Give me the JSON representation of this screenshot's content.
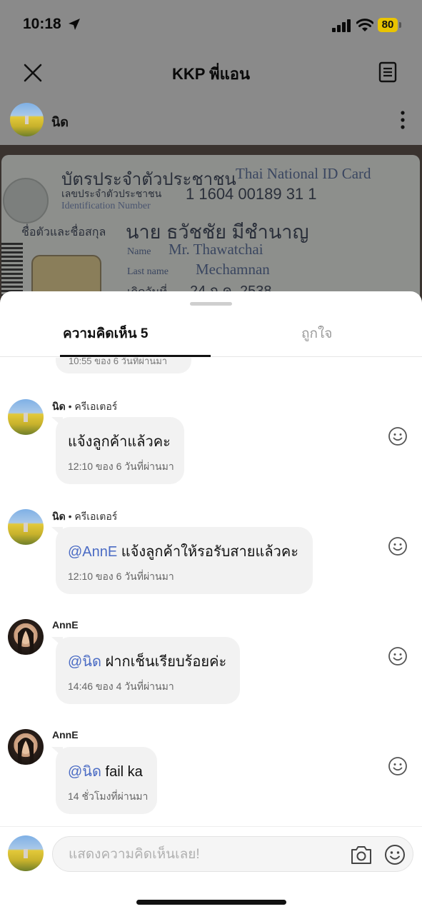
{
  "status_bar": {
    "time": "10:18",
    "battery": "80"
  },
  "header": {
    "title": "KKP พี่แอน"
  },
  "post": {
    "author": "นิด",
    "id_card": {
      "title_th": "บัตรประจำตัวประชาชน",
      "title_en": "Thai National ID Card",
      "id_label_th": "เลขประจำตัวประชาชน",
      "id_label_en": "Identification Number",
      "id_number": "1 1604 00189 31 1",
      "name_label_th": "ชื่อตัวและชื่อสกุล",
      "name_th": "นาย ธวัชชัย มีชำนาญ",
      "name_label_en": "Name",
      "name_en": "Mr. Thawatchai",
      "lastname_label_en": "Last name",
      "lastname_en": "Mechamnan",
      "birth_label_th": "เกิดวันที่",
      "birth_th": "24 ก.ค. 2538"
    }
  },
  "tabs": [
    {
      "label": "ความคิดเห็น 5",
      "active": true
    },
    {
      "label": "ถูกใจ",
      "active": false
    }
  ],
  "partial_comment": {
    "time": "10:55 ของ 6 วันที่ผ่านมา"
  },
  "comments": [
    {
      "author": "นิด",
      "role": "ครีเอเตอร์",
      "mention": "",
      "text": "แจ้งลูกค้าแล้วคะ",
      "time": "12:10 ของ 6 วันที่ผ่านมา"
    },
    {
      "author": "นิด",
      "role": "ครีเอเตอร์",
      "mention": "@AnnE",
      "text": " แจ้งลูกค้าให้รอรับสายแล้วคะ",
      "time": "12:10 ของ 6 วันที่ผ่านมา"
    },
    {
      "author": "AnnE",
      "role": "",
      "mention": "@นิด",
      "text": " ฝากเช็นเรียบร้อยค่ะ",
      "time": "14:46 ของ 4 วันที่ผ่านมา"
    },
    {
      "author": "AnnE",
      "role": "",
      "mention": "@นิด",
      "text": " fail ka",
      "time": "14 ชั่วโมงที่ผ่านมา"
    }
  ],
  "input": {
    "placeholder": "แสดงความคิดเห็นเลย!",
    "value": ""
  },
  "colors": {
    "mention": "#4a6bc4",
    "battery": "#e9c400",
    "overlay": "#8a8a8a"
  },
  "icons": [
    "location-arrow-icon",
    "signal-icon",
    "wifi-icon",
    "battery-icon",
    "close-icon",
    "document-icon",
    "kebab-icon",
    "smiley-icon",
    "camera-icon"
  ]
}
